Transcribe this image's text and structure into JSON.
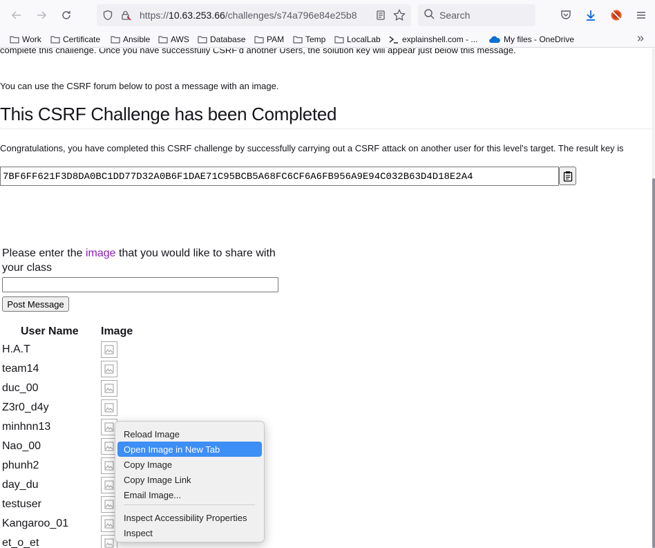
{
  "browser": {
    "url_prefix": "https://",
    "url_host": "10.63.253.66",
    "url_path": "/challenges/s74a796e84e25b8",
    "search_placeholder": "Search"
  },
  "bookmarks": [
    {
      "label": "Work"
    },
    {
      "label": "Certificate"
    },
    {
      "label": "Ansible"
    },
    {
      "label": "AWS"
    },
    {
      "label": "Database"
    },
    {
      "label": "PAM"
    },
    {
      "label": "Temp"
    },
    {
      "label": "LocalLab"
    },
    {
      "label": "explainshell.com - ..."
    },
    {
      "label": "My files - OneDrive"
    }
  ],
  "page": {
    "cut_text": "complete this challenge. Once you have successfully CSRF'd another Users, the solution key will appear just below this message.",
    "intro": "You can use the CSRF forum below to post a message with an image.",
    "heading": "This CSRF Challenge has been Completed",
    "congrats": "Congratulations, you have completed this CSRF challenge by successfully carrying out a CSRF attack on another user for this level's target. The result key is",
    "result_key": "7BF6FF621F3D8DA0BC1DD77D32A0B6F1DAE71C95BCB5A68FC6CF6A6FB956A9E94C032B63D4D18E2A4",
    "prompt_before": "Please enter the ",
    "prompt_highlight": "image",
    "prompt_after": " that you would like to share with your class",
    "post_button": "Post Message",
    "col_user": "User Name",
    "col_image": "Image",
    "users": [
      "H.A.T",
      "team14",
      "duc_00",
      "Z3r0_d4y",
      "minhnn13",
      "Nao_00",
      "phunh2",
      "day_du",
      "testuser",
      "Kangaroo_01",
      "et_o_et"
    ]
  },
  "context_menu": {
    "items": [
      {
        "label": "Reload Image"
      },
      {
        "label": "Open Image in New Tab",
        "active": true
      },
      {
        "label": "Copy Image"
      },
      {
        "label": "Copy Image Link"
      },
      {
        "label": "Email Image..."
      },
      {
        "label": "Inspect Accessibility Properties"
      },
      {
        "label": "Inspect"
      }
    ]
  },
  "colors": {
    "highlight": "#8a1fb5",
    "menu_active": "#3d8ef5",
    "download_icon": "#0060df"
  }
}
